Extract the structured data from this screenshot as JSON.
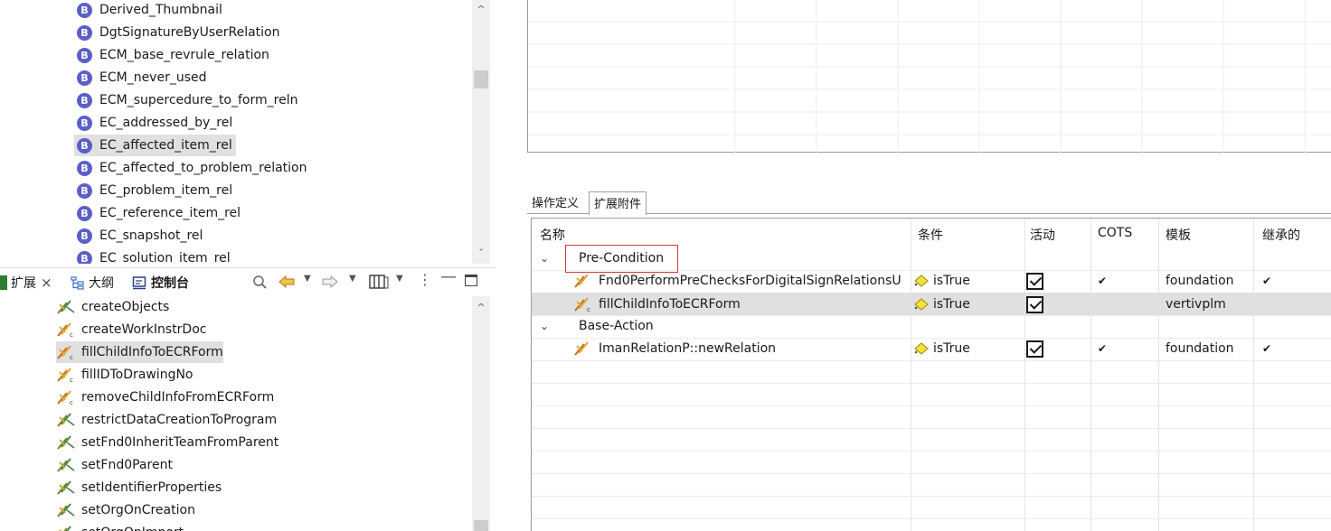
{
  "top_tree": {
    "items": [
      {
        "label": "Derived_Thumbnail"
      },
      {
        "label": "DgtSignatureByUserRelation"
      },
      {
        "label": "ECM_base_revrule_relation"
      },
      {
        "label": "ECM_never_used"
      },
      {
        "label": "ECM_supercedure_to_form_reln"
      },
      {
        "label": "EC_addressed_by_rel"
      },
      {
        "label": "EC_affected_item_rel",
        "selected": true
      },
      {
        "label": "EC_affected_to_problem_relation"
      },
      {
        "label": "EC_problem_item_rel"
      },
      {
        "label": "EC_reference_item_rel"
      },
      {
        "label": "EC_snapshot_rel"
      },
      {
        "label": "EC_solution_item_rel"
      }
    ],
    "icon_letter": "B"
  },
  "toolbar": {
    "tabs": [
      {
        "label": "扩展"
      },
      {
        "label": "大纲"
      },
      {
        "label": "控制台"
      }
    ],
    "close_glyph": "×"
  },
  "bottom_list": {
    "items": [
      {
        "label": "createObjects"
      },
      {
        "label": "createWorkInstrDoc"
      },
      {
        "label": "fillChildInfoToECRForm",
        "selected": true
      },
      {
        "label": "fillIDToDrawingNo"
      },
      {
        "label": "removeChildInfoFromECRForm"
      },
      {
        "label": "restrictDataCreationToProgram"
      },
      {
        "label": "setFnd0InheritTeamFromParent"
      },
      {
        "label": "setFnd0Parent"
      },
      {
        "label": "setIdentifierProperties"
      },
      {
        "label": "setOrgOnCreation"
      },
      {
        "label": "setOrgOnImport"
      }
    ]
  },
  "right_tabs": [
    {
      "label": "操作定义"
    },
    {
      "label": "扩展附件",
      "active": true
    }
  ],
  "table": {
    "headers": {
      "name": "名称",
      "condition": "条件",
      "active": "活动",
      "cots": "COTS",
      "template": "模板",
      "inherited": "继承的"
    },
    "groups": [
      {
        "label": "Pre-Condition",
        "rows": [
          {
            "name": "Fnd0PerformPreChecksForDigitalSignRelationsU",
            "condition": "isTrue",
            "active": true,
            "cots": "✔",
            "template": "foundation",
            "inherited": "✔"
          },
          {
            "name": "fillChildInfoToECRForm",
            "condition": "isTrue",
            "active": true,
            "cots": "",
            "template": "vertivplm",
            "inherited": "",
            "selected": true
          }
        ]
      },
      {
        "label": "Base-Action",
        "rows": [
          {
            "name": "ImanRelationP::newRelation",
            "condition": "isTrue",
            "active": true,
            "cots": "✔",
            "template": "foundation",
            "inherited": "✔"
          }
        ]
      }
    ]
  },
  "colors": {
    "selection": "#e0e0e0",
    "highlight_box": "#d23c3c",
    "b_icon": "#5b5fc7"
  }
}
